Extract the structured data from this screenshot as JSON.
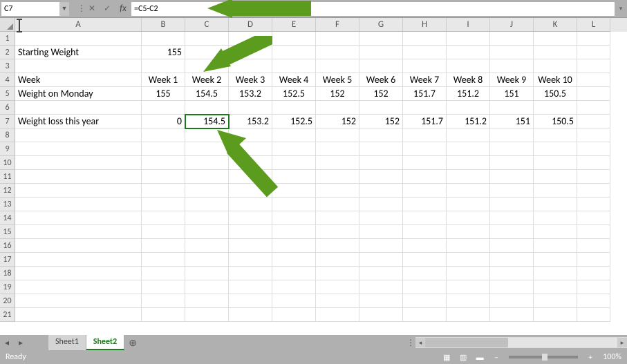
{
  "formula_bar": {
    "name_box": "C7",
    "formula": "=C5-C2"
  },
  "columns": [
    "A",
    "B",
    "C",
    "D",
    "E",
    "F",
    "G",
    "H",
    "I",
    "J",
    "K",
    "L"
  ],
  "col_classes": [
    "cA",
    "cB",
    "cC",
    "cD",
    "cE",
    "cF",
    "cG",
    "cH",
    "cI",
    "cJ",
    "cK",
    "cL"
  ],
  "visible_rows": 21,
  "active_cell": {
    "row": 7,
    "col": 2
  },
  "rows": {
    "2": {
      "A": {
        "v": "Starting Weight",
        "t": "txt"
      },
      "B": {
        "v": "155",
        "t": "num"
      }
    },
    "4": {
      "A": {
        "v": "Week",
        "t": "txt"
      },
      "B": {
        "v": "Week 1",
        "t": "ctr"
      },
      "C": {
        "v": "Week 2",
        "t": "ctr"
      },
      "D": {
        "v": "Week 3",
        "t": "ctr"
      },
      "E": {
        "v": "Week 4",
        "t": "ctr"
      },
      "F": {
        "v": "Week 5",
        "t": "ctr"
      },
      "G": {
        "v": "Week 6",
        "t": "ctr"
      },
      "H": {
        "v": "Week 7",
        "t": "ctr"
      },
      "I": {
        "v": "Week 8",
        "t": "ctr"
      },
      "J": {
        "v": "Week 9",
        "t": "ctr"
      },
      "K": {
        "v": "Week 10",
        "t": "ctr"
      }
    },
    "5": {
      "A": {
        "v": "Weight on Monday",
        "t": "txt"
      },
      "B": {
        "v": "155",
        "t": "ctr"
      },
      "C": {
        "v": "154.5",
        "t": "ctr"
      },
      "D": {
        "v": "153.2",
        "t": "ctr"
      },
      "E": {
        "v": "152.5",
        "t": "ctr"
      },
      "F": {
        "v": "152",
        "t": "ctr"
      },
      "G": {
        "v": "152",
        "t": "ctr"
      },
      "H": {
        "v": "151.7",
        "t": "ctr"
      },
      "I": {
        "v": "151.2",
        "t": "ctr"
      },
      "J": {
        "v": "151",
        "t": "ctr"
      },
      "K": {
        "v": "150.5",
        "t": "ctr"
      }
    },
    "7": {
      "A": {
        "v": "Weight loss this year",
        "t": "txt"
      },
      "B": {
        "v": "0",
        "t": "num"
      },
      "C": {
        "v": "154.5",
        "t": "num"
      },
      "D": {
        "v": "153.2",
        "t": "num"
      },
      "E": {
        "v": "152.5",
        "t": "num"
      },
      "F": {
        "v": "152",
        "t": "num"
      },
      "G": {
        "v": "152",
        "t": "num"
      },
      "H": {
        "v": "151.7",
        "t": "num"
      },
      "I": {
        "v": "151.2",
        "t": "num"
      },
      "J": {
        "v": "151",
        "t": "num"
      },
      "K": {
        "v": "150.5",
        "t": "num"
      }
    }
  },
  "tabs": {
    "items": [
      "Sheet1",
      "Sheet2"
    ],
    "active": 1
  },
  "status": {
    "ready": "Ready",
    "zoom": "100%"
  },
  "chart_data": {
    "type": "table",
    "title": "Weight Tracking",
    "starting_weight": 155,
    "weeks": [
      "Week 1",
      "Week 2",
      "Week 3",
      "Week 4",
      "Week 5",
      "Week 6",
      "Week 7",
      "Week 8",
      "Week 9",
      "Week 10"
    ],
    "weight_on_monday": [
      155,
      154.5,
      153.2,
      152.5,
      152,
      152,
      151.7,
      151.2,
      151,
      150.5
    ],
    "weight_loss_this_year": [
      0,
      154.5,
      153.2,
      152.5,
      152,
      152,
      151.7,
      151.2,
      151,
      150.5
    ],
    "formula_shown": "=C5-C2"
  }
}
